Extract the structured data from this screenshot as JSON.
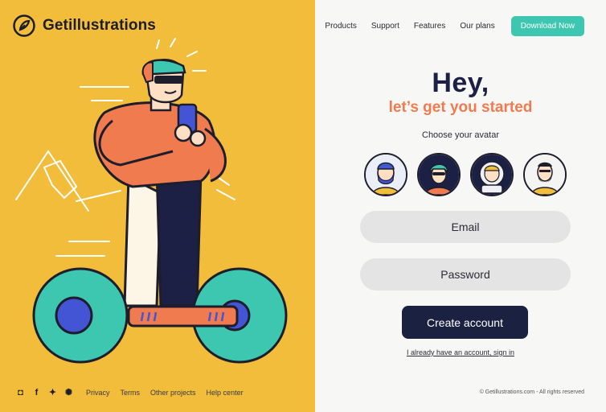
{
  "brand": {
    "name": "Getillustrations"
  },
  "nav": {
    "items": [
      "Products",
      "Support",
      "Features",
      "Our plans"
    ],
    "cta": "Download Now"
  },
  "greeting": {
    "title": "Hey,",
    "subtitle": "let’s get you started",
    "choose_label": "Choose your avatar"
  },
  "form": {
    "email_placeholder": "Email",
    "password_placeholder": "Password",
    "create_label": "Create account",
    "signin_link": "I already have an account, sign in"
  },
  "footer": {
    "social_icons": [
      "instagram-icon",
      "facebook-icon",
      "twitter-icon",
      "dribbble-icon"
    ],
    "links": [
      "Privacy",
      "Terms",
      "Other projects",
      "Help center"
    ],
    "copyright": "© Getillustrations.com - All rights reserved"
  },
  "colors": {
    "yellow": "#f2bd3b",
    "teal": "#3ec7b0",
    "navy": "#1b2140",
    "orange": "#f07b4f"
  }
}
